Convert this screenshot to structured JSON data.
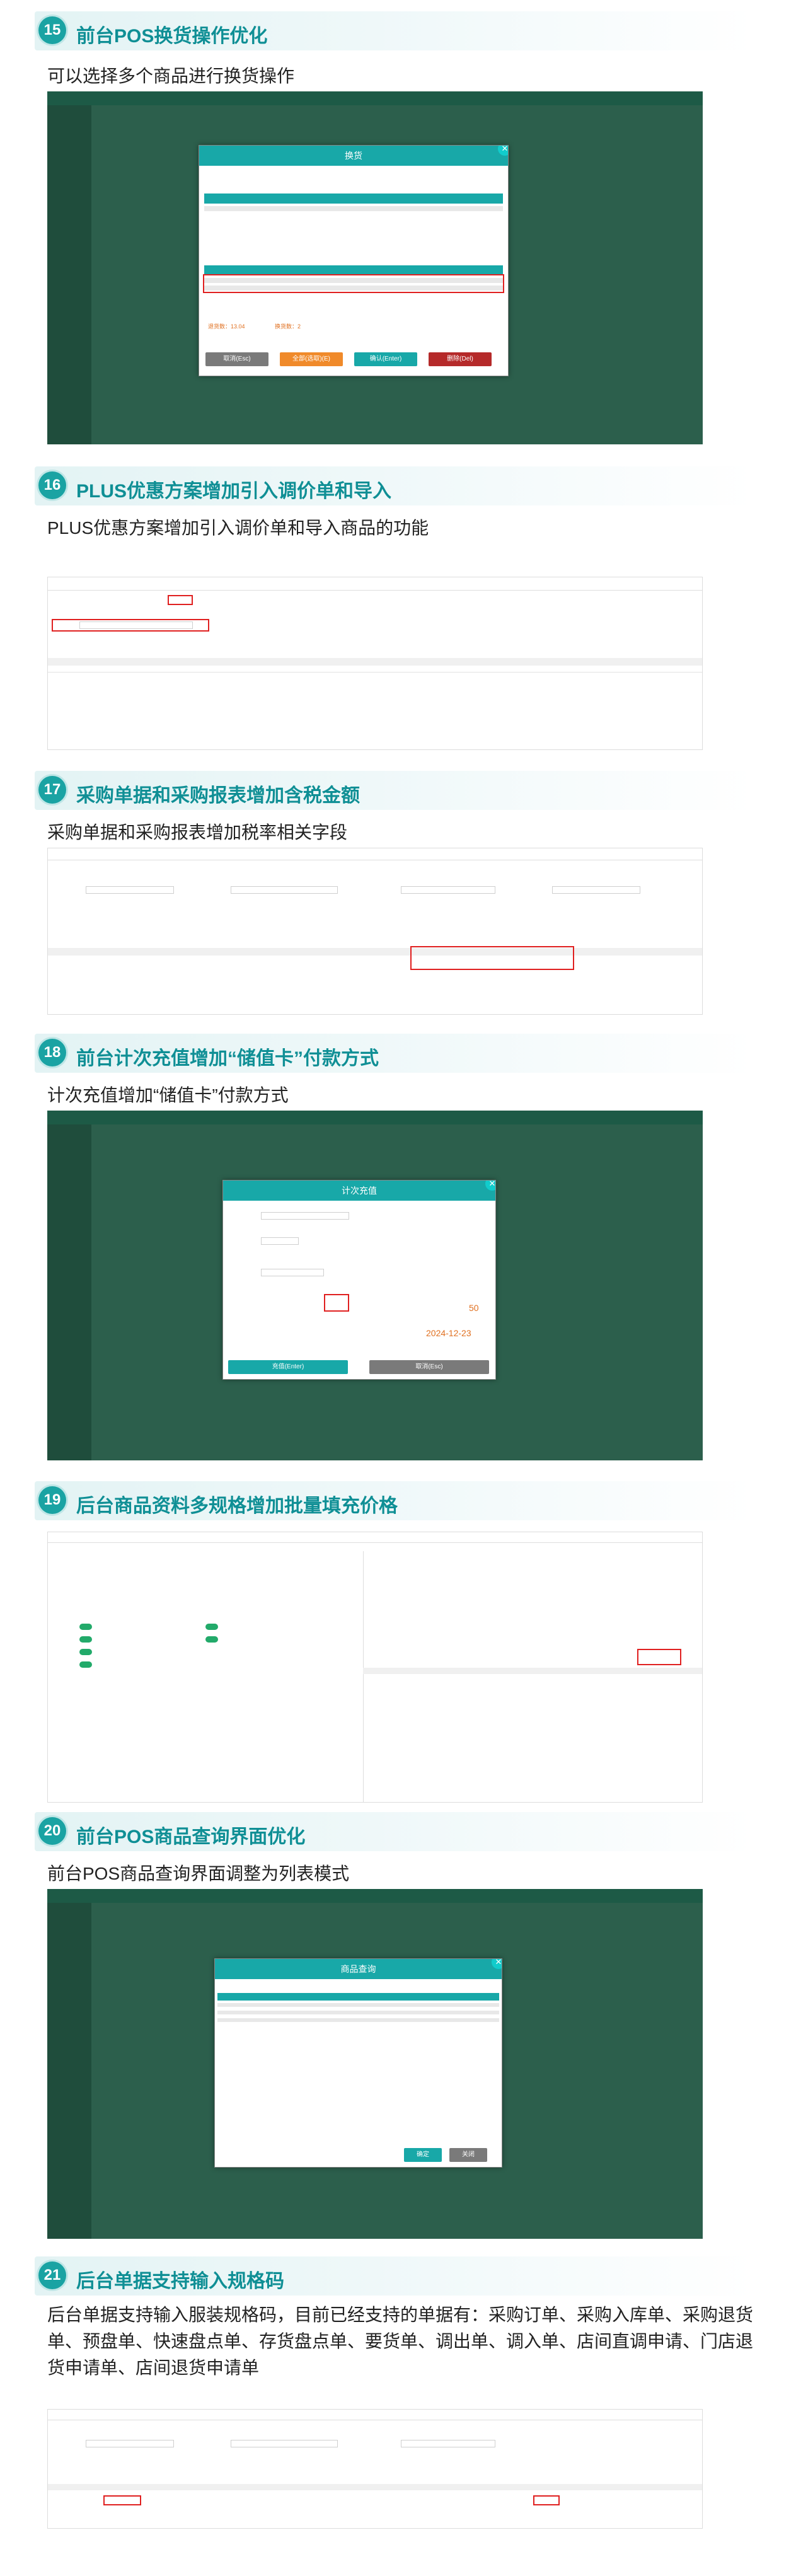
{
  "sections": [
    {
      "num": "15",
      "title": "前台POS换货操作优化",
      "desc": "可以选择多个商品进行换货操作",
      "shot": {
        "dialog_title": "换货",
        "buttons": [
          "取消(Esc)",
          "全部(选取)(E)",
          "确认(Enter)",
          "删除(Del)"
        ],
        "amount_text": "退货数：13.04",
        "amount_text2": "换货数：2"
      }
    },
    {
      "num": "16",
      "title": "PLUS优惠方案增加引入调价单和导入",
      "desc": "PLUS优惠方案增加引入调价单和导入商品的功能"
    },
    {
      "num": "17",
      "title": "采购单据和采购报表增加含税金额",
      "desc": "采购单据和采购报表增加税率相关字段"
    },
    {
      "num": "18",
      "title": "前台计次充值增加“储值卡”付款方式",
      "desc": "计次充值增加“储值卡”付款方式",
      "shot": {
        "dialog_title": "计次充值",
        "value1": "50",
        "date": "2024-12-23",
        "buttons": [
          "充值(Enter)",
          "取消(Esc)"
        ]
      }
    },
    {
      "num": "19",
      "title": "后台商品资料多规格增加批量填充价格",
      "desc": ""
    },
    {
      "num": "20",
      "title": "前台POS商品查询界面优化",
      "desc": "前台POS商品查询界面调整为列表模式",
      "shot": {
        "dialog_title": "商品查询",
        "buttons": [
          "确定",
          "关闭"
        ]
      }
    },
    {
      "num": "21",
      "title": "后台单据支持输入规格码",
      "desc": "后台单据支持输入服装规格码，目前已经支持的单据有：采购订单、采购入库单、采购退货单、预盘单、快速盘点单、存货盘点单、要货单、调出单、调入单、店间直调申请、门店退货申请单、店间退货申请单"
    }
  ],
  "colors": {
    "accent": "#1aa3a3",
    "title": "#0f8f95",
    "dark_bg": "#2c5f4c",
    "highlight": "#e02020"
  }
}
